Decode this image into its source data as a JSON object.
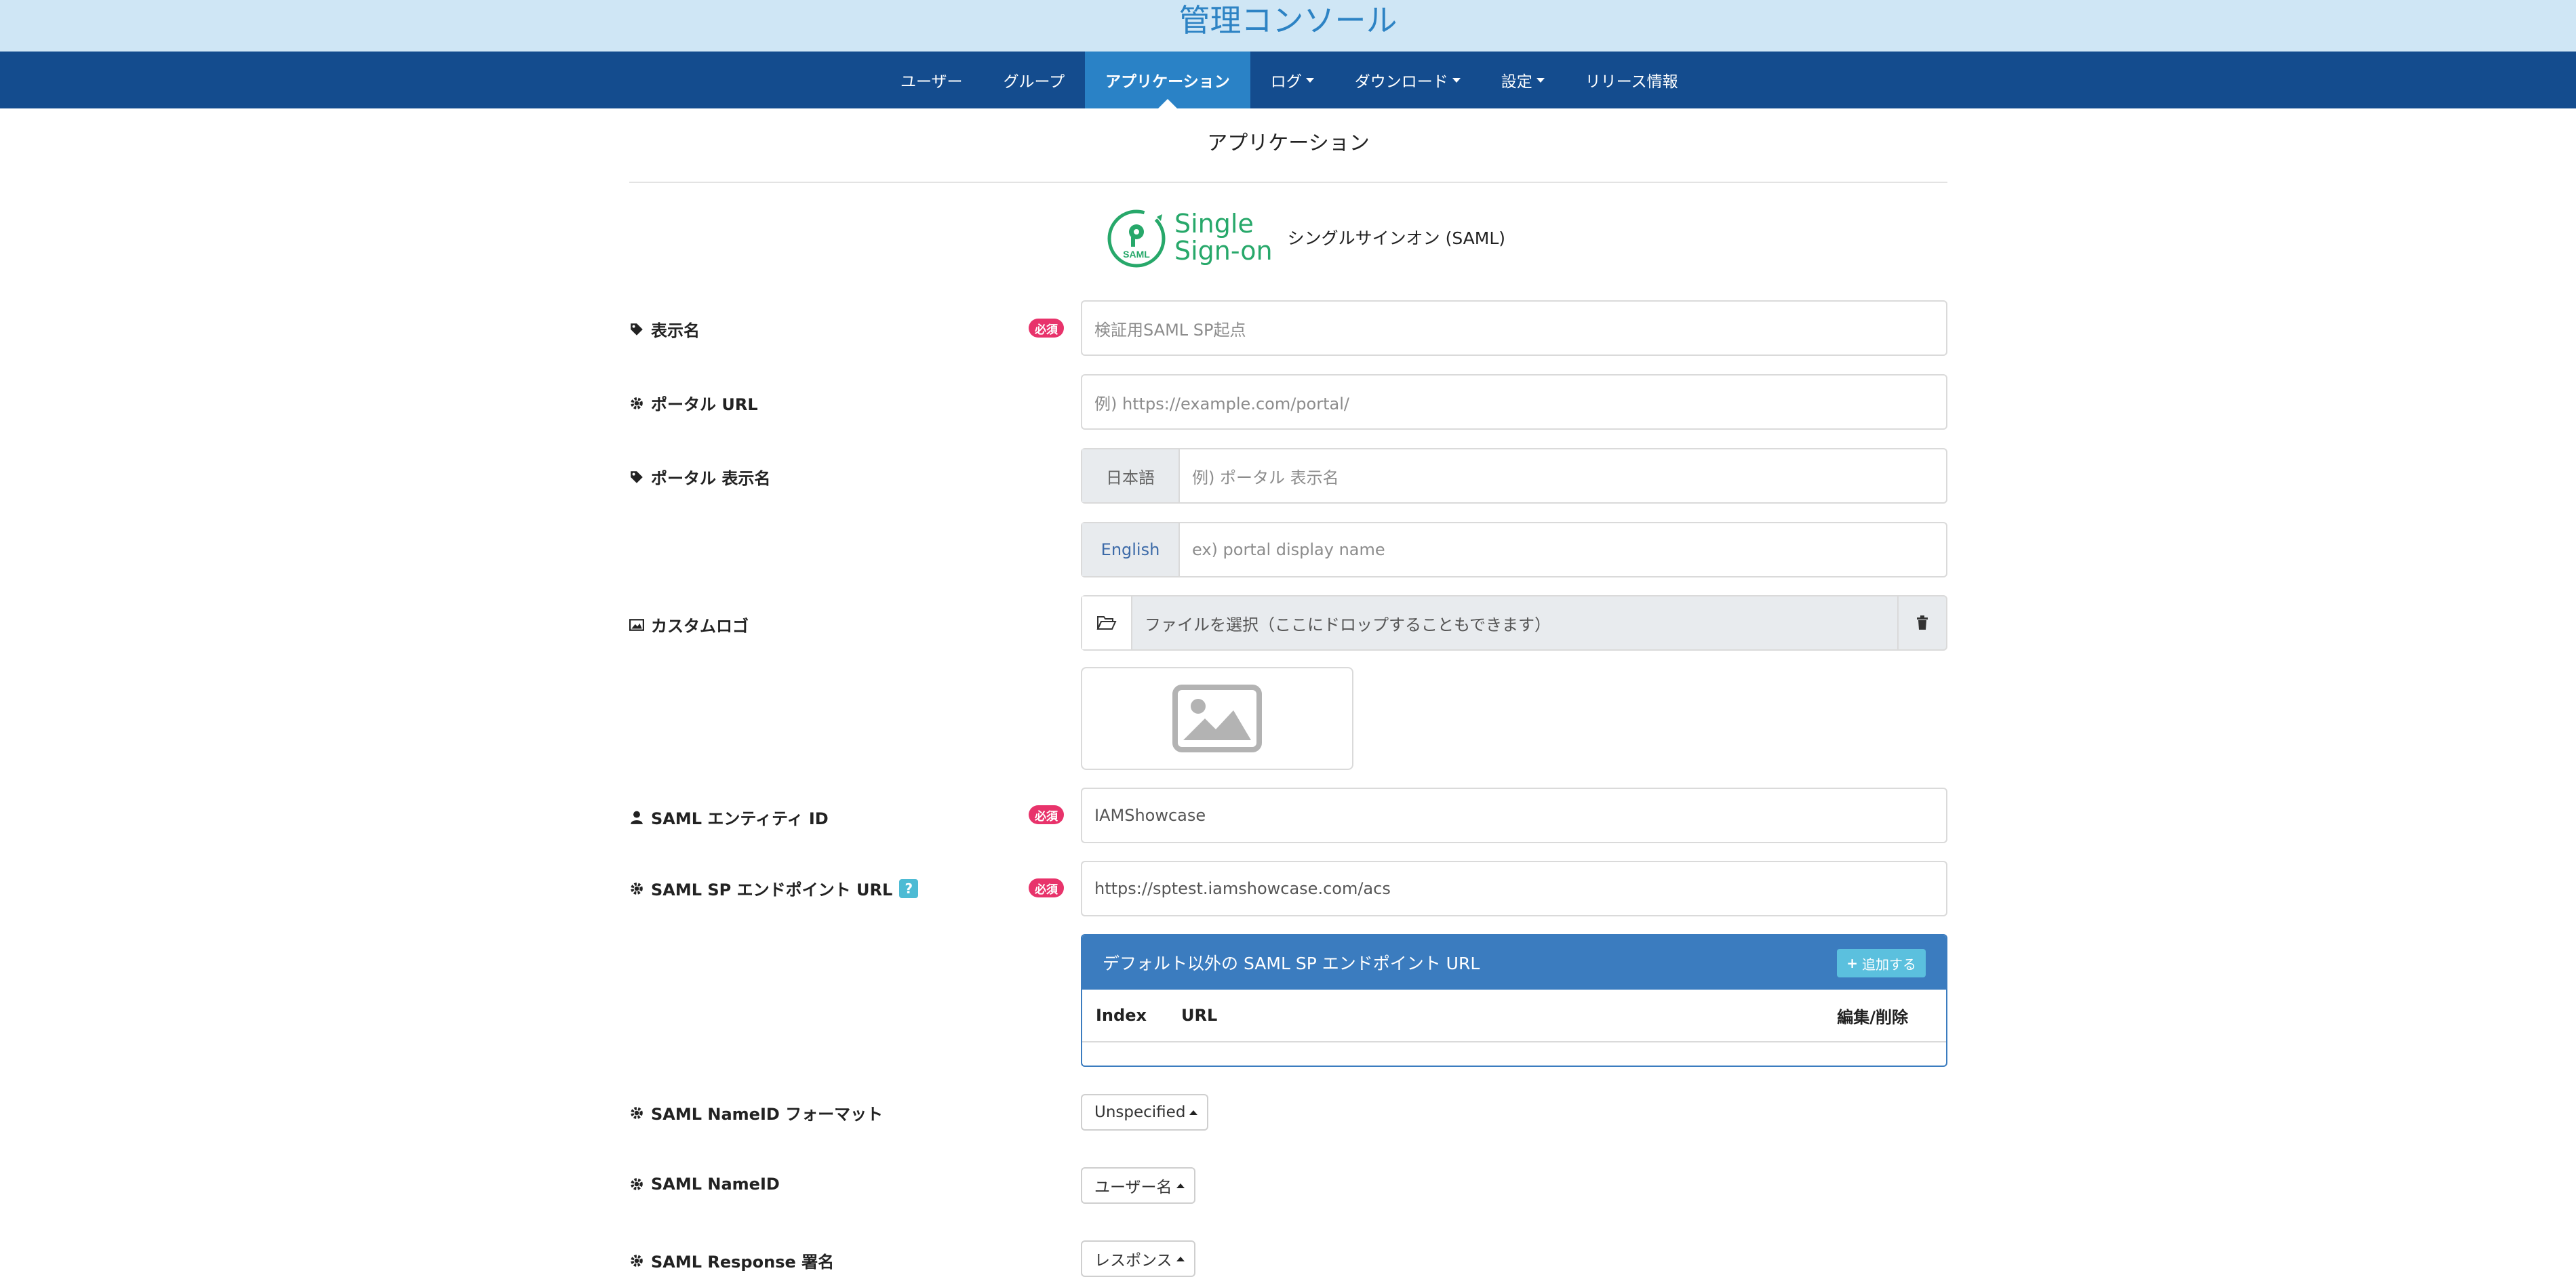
{
  "header": {
    "title": "管理コンソール"
  },
  "nav": {
    "items": [
      {
        "label": "ユーザー"
      },
      {
        "label": "グループ"
      },
      {
        "label": "アプリケーション"
      },
      {
        "label": "ログ"
      },
      {
        "label": "ダウンロード"
      },
      {
        "label": "設定"
      },
      {
        "label": "リリース情報"
      }
    ]
  },
  "page": {
    "heading": "アプリケーション",
    "sso_logo_line1": "Single",
    "sso_logo_line2": "Sign-on",
    "sso_badge": "SAML",
    "sso_caption": "シングルサインオン (SAML)"
  },
  "required_badge": "必須",
  "form": {
    "display_name": {
      "label": "表示名",
      "value": "検証用SAML SP起点"
    },
    "portal_url": {
      "label": "ポータル URL",
      "placeholder": "例) https://example.com/portal/"
    },
    "portal_display_name": {
      "label": "ポータル 表示名",
      "ja_addon": "日本語",
      "ja_placeholder": "例) ポータル 表示名",
      "en_addon": "English",
      "en_placeholder": "ex) portal display name"
    },
    "custom_logo": {
      "label": "カスタムロゴ",
      "file_text": "ファイルを選択（ここにドロップすることもできます）"
    },
    "entity_id": {
      "label": "SAML エンティティ ID",
      "value": "IAMShowcase"
    },
    "sp_endpoint": {
      "label": "SAML SP エンドポイント URL",
      "help": "?",
      "value": "https://sptest.iamshowcase.com/acs"
    },
    "extra_endpoints": {
      "title": "デフォルト以外の SAML SP エンドポイント URL",
      "add_label": "追加する",
      "col_index": "Index",
      "col_url": "URL",
      "col_edit": "編集/削除"
    },
    "nameid_format": {
      "label": "SAML NameID フォーマット",
      "value": "Unspecified"
    },
    "nameid": {
      "label": "SAML NameID",
      "value": "ユーザー名"
    },
    "response_sign": {
      "label": "SAML Response 署名",
      "value": "レスポンス"
    }
  },
  "colors": {
    "navbar": "#144c8e",
    "nav_active": "#2a82c6",
    "topbar": "#cfe6f5",
    "required": "#e8336b",
    "panel": "#3b7cbf",
    "sso_green": "#27a86a"
  }
}
